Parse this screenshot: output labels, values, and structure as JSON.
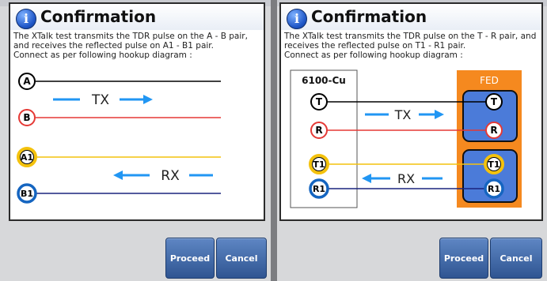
{
  "left": {
    "dialog": {
      "title": "Confirmation",
      "description": "The XTalk test transmits the TDR pulse on the A - B pair, and receives the reflected pulse on A1 - B1 pair.",
      "instruction": "Connect as per following hookup diagram :"
    },
    "diagram": {
      "labels": [
        "A",
        "B",
        "A1",
        "B1"
      ],
      "tx_label": "TX",
      "rx_label": "RX"
    },
    "buttons": {
      "proceed": "Proceed",
      "cancel": "Cancel"
    }
  },
  "right": {
    "dialog": {
      "title": "Confirmation",
      "description": "The XTalk test transmits the TDR pulse on the T - R pair, and receives the reflected pulse on T1 - R1 pair.",
      "instruction": "Connect as per following hookup diagram :"
    },
    "diagram": {
      "device_left": "6100-Cu",
      "device_right": "FED",
      "labels": [
        "T",
        "R",
        "T1",
        "R1"
      ],
      "tx_label": "TX",
      "rx_label": "RX"
    },
    "buttons": {
      "proceed": "Proceed",
      "cancel": "Cancel"
    }
  },
  "colors": {
    "tx_arrow": "#2196f3",
    "line_a": "#000000",
    "line_b": "#e53935",
    "line_a1": "#f4c20d",
    "line_b1": "#1a237e",
    "fed_box": "#f5891f",
    "fed_inner": "#4b7bd9",
    "button": "#3c64a3"
  },
  "icons": {
    "info": "info-icon"
  }
}
